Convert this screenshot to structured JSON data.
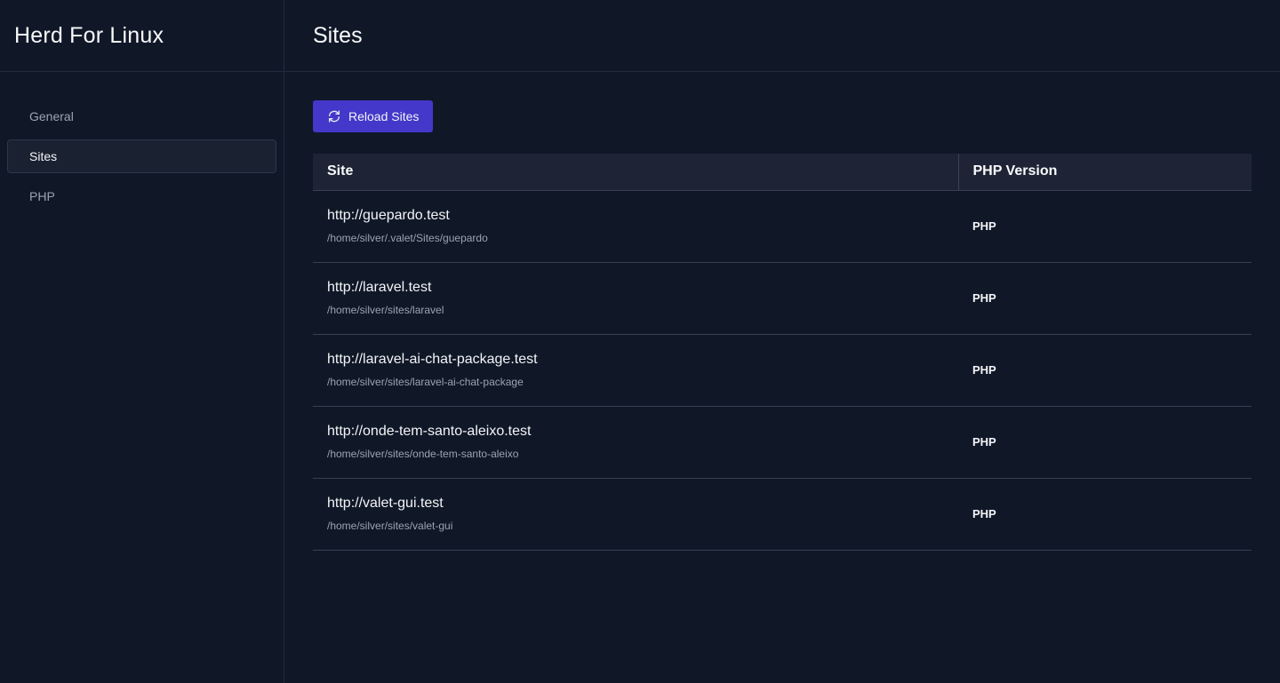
{
  "sidebar": {
    "title": "Herd For Linux",
    "items": [
      {
        "label": "General",
        "active": false
      },
      {
        "label": "Sites",
        "active": true
      },
      {
        "label": "PHP",
        "active": false
      }
    ]
  },
  "main": {
    "title": "Sites",
    "reload_button": {
      "label": "Reload Sites",
      "icon": "refresh-icon"
    },
    "table": {
      "headers": {
        "site": "Site",
        "php": "PHP Version"
      },
      "rows": [
        {
          "url": "http://guepardo.test",
          "path": "/home/silver/.valet/Sites/guepardo",
          "php": "PHP"
        },
        {
          "url": "http://laravel.test",
          "path": "/home/silver/sites/laravel",
          "php": "PHP"
        },
        {
          "url": "http://laravel-ai-chat-package.test",
          "path": "/home/silver/sites/laravel-ai-chat-package",
          "php": "PHP"
        },
        {
          "url": "http://onde-tem-santo-aleixo.test",
          "path": "/home/silver/sites/onde-tem-santo-aleixo",
          "php": "PHP"
        },
        {
          "url": "http://valet-gui.test",
          "path": "/home/silver/sites/valet-gui",
          "php": "PHP"
        }
      ]
    }
  },
  "colors": {
    "background": "#101828",
    "accent": "#4338ca",
    "table_header": "#1e2435",
    "muted_text": "#9ca3af"
  }
}
